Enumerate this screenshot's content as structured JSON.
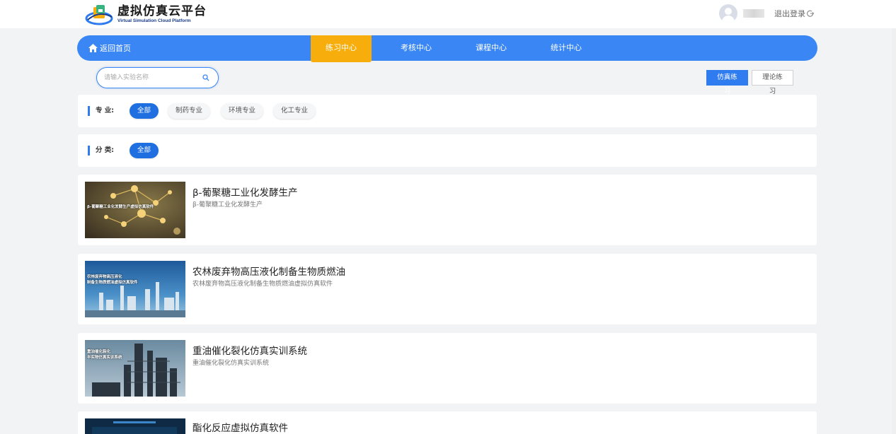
{
  "header": {
    "logo_title": "虚拟仿真云平台",
    "logo_subtitle": "Virtual Simulation Cloud Platform",
    "logout_label": "退出登录",
    "logout_icon": "logout-icon"
  },
  "nav": {
    "home_label": "返回首页",
    "tabs": [
      {
        "label": "练习中心",
        "active": true
      },
      {
        "label": "考核中心",
        "active": false
      },
      {
        "label": "课程中心",
        "active": false
      },
      {
        "label": "统计中心",
        "active": false
      }
    ]
  },
  "search": {
    "placeholder": "请输入实验名称",
    "value": ""
  },
  "mode_buttons": [
    {
      "label": "仿真练习",
      "active": true
    },
    {
      "label": "理论练习",
      "active": false
    }
  ],
  "filters": {
    "major": {
      "label": "专 业:",
      "options": [
        {
          "label": "全部",
          "active": true
        },
        {
          "label": "制药专业",
          "active": false
        },
        {
          "label": "环境专业",
          "active": false
        },
        {
          "label": "化工专业",
          "active": false
        }
      ]
    },
    "category": {
      "label": "分 类:",
      "options": [
        {
          "label": "全部",
          "active": true
        }
      ]
    }
  },
  "experiments": [
    {
      "title": "β-葡聚糖工业化发酵生产",
      "description": "β-葡聚糖工业化发酵生产",
      "thumb_caption": "β-葡聚糖工业化发酵生产虚拟仿真软件"
    },
    {
      "title": "农林废弃物高压液化制备生物质燃油",
      "description": "农林废弃物高压液化制备生物质燃油虚拟仿真软件",
      "thumb_caption_1": "农林废弃物高压液化",
      "thumb_caption_2": "制备生物质燃油虚拟仿真软件"
    },
    {
      "title": "重油催化裂化仿真实训系统",
      "description": "重油催化裂化仿真实训系统",
      "thumb_caption_1": "重油催化裂化",
      "thumb_caption_2": "半实物仿真实训系统"
    },
    {
      "title": "酯化反应虚拟仿真软件",
      "description": "",
      "thumb_caption": ""
    }
  ],
  "colors": {
    "primary": "#3a86f5",
    "active_tab": "#f7ae0c",
    "chip_active": "#1f6fe0",
    "background": "#f2f3f5"
  }
}
